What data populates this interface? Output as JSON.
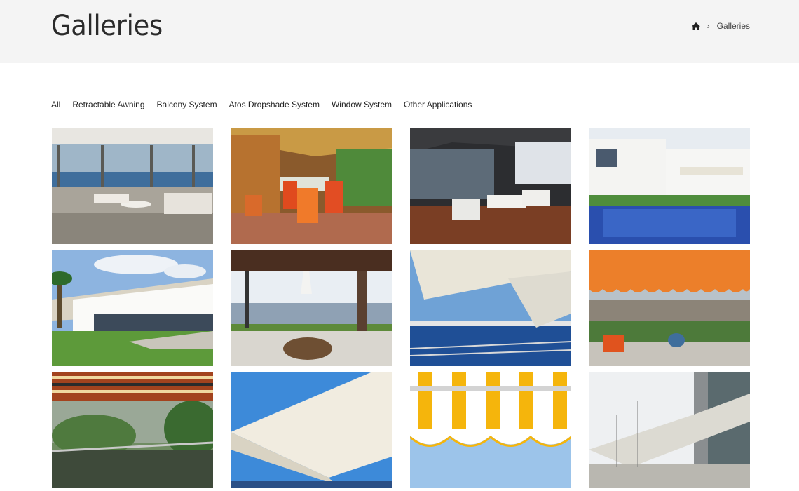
{
  "header": {
    "title": "Galleries",
    "breadcrumb": {
      "home_icon": "home-icon",
      "separator": "›",
      "current": "Galleries"
    }
  },
  "filters": [
    {
      "label": "All"
    },
    {
      "label": "Retractable Awning"
    },
    {
      "label": "Balcony System"
    },
    {
      "label": "Atos Dropshade System"
    },
    {
      "label": "Window System"
    },
    {
      "label": "Other Applications"
    }
  ],
  "gallery": {
    "items": [
      {
        "scene": "living-room-sea-view"
      },
      {
        "scene": "conservatory-orange-chairs"
      },
      {
        "scene": "terrace-white-sofas"
      },
      {
        "scene": "villa-pool"
      },
      {
        "scene": "white-villa-lawn"
      },
      {
        "scene": "covered-terrace-bathtub"
      },
      {
        "scene": "awning-over-sea"
      },
      {
        "scene": "orange-awning-city-view"
      },
      {
        "scene": "striped-awning-rain"
      },
      {
        "scene": "cream-awning-sky"
      },
      {
        "scene": "yellow-striped-valance"
      },
      {
        "scene": "awning-street-view"
      }
    ]
  },
  "colors": {
    "header_bg": "#f4f4f4",
    "text": "#222222"
  }
}
